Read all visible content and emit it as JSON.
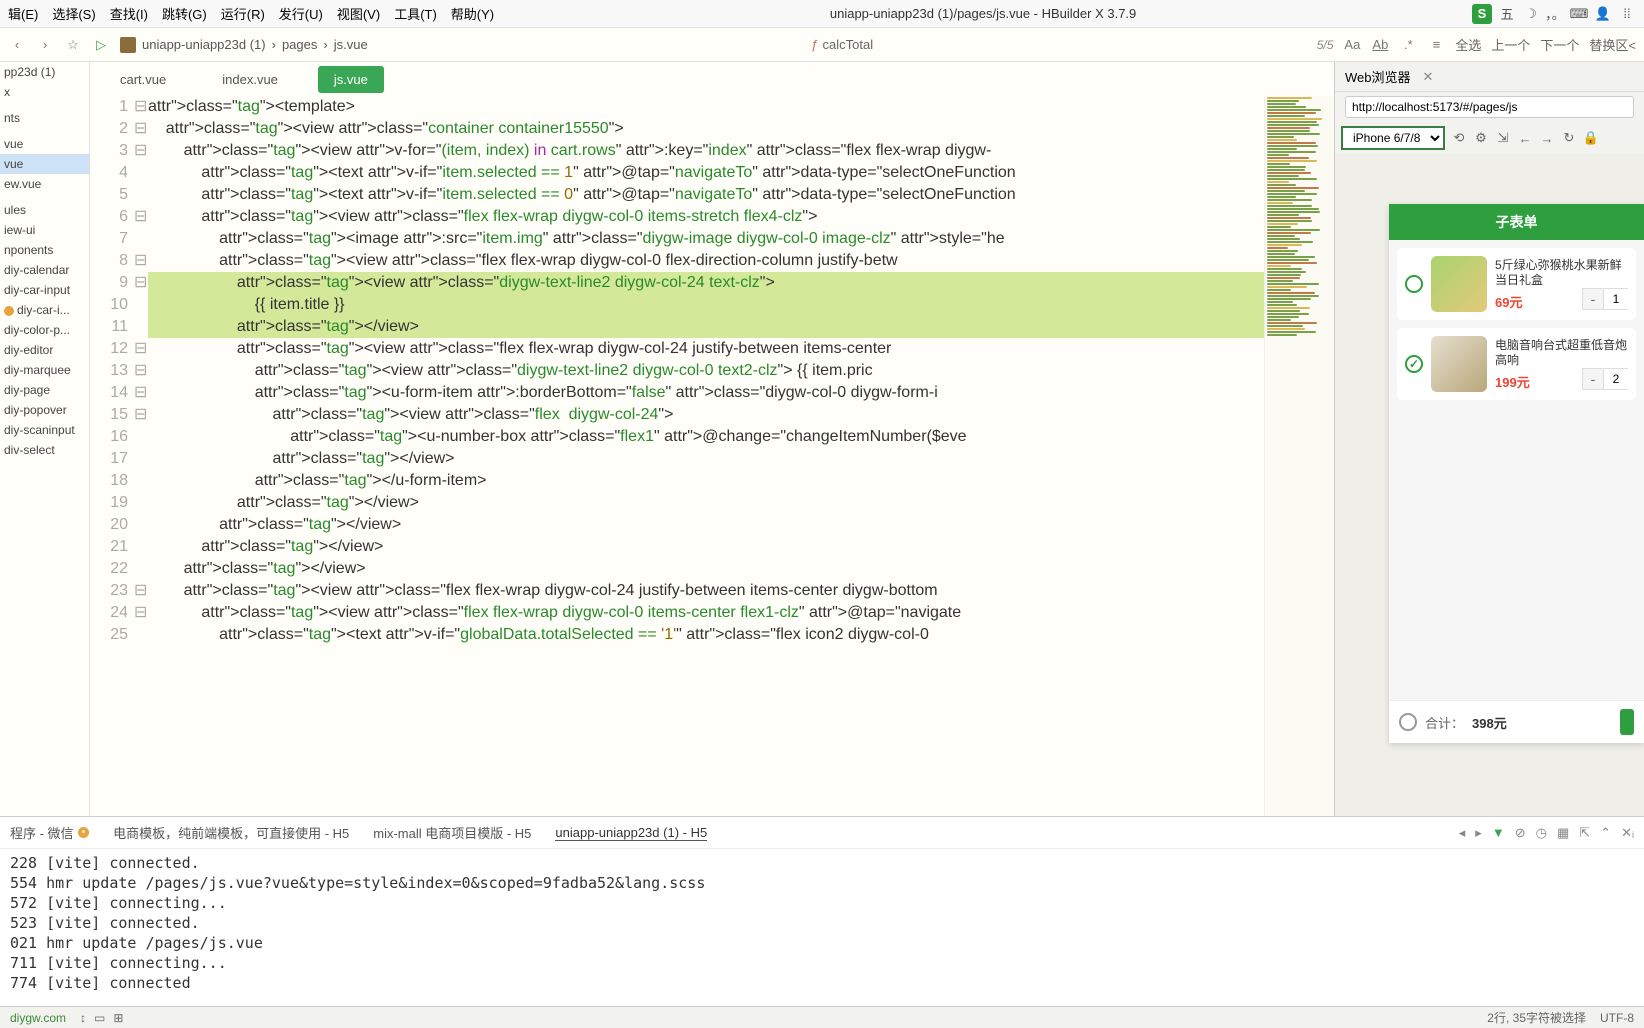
{
  "menubar": {
    "items": [
      "辑(E)",
      "选择(S)",
      "查找(I)",
      "跳转(G)",
      "运行(R)",
      "发行(U)",
      "视图(V)",
      "工具(T)",
      "帮助(Y)"
    ],
    "title": "uniapp-uniapp23d (1)/pages/js.vue - HBuilder X 3.7.9"
  },
  "toolbar": {
    "breadcrumb": [
      "uniapp-uniapp23d (1)",
      "pages",
      "js.vue"
    ],
    "func": "calcTotal",
    "count": "5/5",
    "actions": [
      "全选",
      "上一个",
      "下一个",
      "替换区<"
    ]
  },
  "sidebar": {
    "items": [
      "pp23d (1)",
      "x",
      "",
      "nts",
      "",
      "vue",
      "vue",
      "ew.vue",
      "",
      "ules",
      "iew-ui",
      "nponents",
      "diy-calendar",
      "diy-car-input",
      "diy-car-i...",
      "diy-color-p...",
      "diy-editor",
      "diy-marquee",
      "diy-page",
      "diy-popover",
      "diy-scaninput",
      "div-select"
    ]
  },
  "tabs": [
    {
      "label": "cart.vue",
      "active": false
    },
    {
      "label": "index.vue",
      "active": false
    },
    {
      "label": "js.vue",
      "active": true
    }
  ],
  "code": {
    "lines": [
      "<template>",
      "    <view class=\"container container15550\">",
      "        <view v-for=\"(item, index) in cart.rows\" :key=\"index\" class=\"flex flex-wrap diygw-",
      "            <text v-if=\"item.selected == 1\" @tap=\"navigateTo\" data-type=\"selectOneFunction",
      "            <text v-if=\"item.selected == 0\" @tap=\"navigateTo\" data-type=\"selectOneFunction",
      "            <view class=\"flex flex-wrap diygw-col-0 items-stretch flex4-clz\">",
      "                <image :src=\"item.img\" class=\"diygw-image diygw-col-0 image-clz\" style=\"he",
      "                <view class=\"flex flex-wrap diygw-col-0 flex-direction-column justify-betw",
      "                    <view class=\"diygw-text-line2 diygw-col-24 text-clz\">",
      "                        {{ item.title }}",
      "                    </view>",
      "                    <view class=\"flex flex-wrap diygw-col-24 justify-between items-center ",
      "                        <view class=\"diygw-text-line2 diygw-col-0 text2-clz\"> {{ item.pric",
      "                        <u-form-item :borderBottom=\"false\" class=\"diygw-col-0 diygw-form-i",
      "                            <view class=\"flex  diygw-col-24\">",
      "                                <u-number-box class=\"flex1\" @change=\"changeItemNumber($eve",
      "                            </view>",
      "                        </u-form-item>",
      "                    </view>",
      "                </view>",
      "            </view>",
      "        </view>",
      "        <view class=\"flex flex-wrap diygw-col-24 justify-between items-center diygw-bottom",
      "            <view class=\"flex flex-wrap diygw-col-0 items-center flex1-clz\" @tap=\"navigate",
      "                <text v-if=\"globalData.totalSelected == '1'\" class=\"flex icon2 diygw-col-0"
    ],
    "highlighted": [
      9,
      10,
      11
    ]
  },
  "preview": {
    "tab": "Web浏览器",
    "url": "http://localhost:5173/#/pages/js",
    "device": "iPhone 6/7/8",
    "header": "子表单",
    "products": [
      {
        "title": "5斤绿心弥猴桃水果新鲜当日礼盒",
        "price": "69元",
        "qty": 1,
        "selected": false,
        "img": "kiwi"
      },
      {
        "title": "电脑音响台式超重低音炮高响",
        "price": "199元",
        "qty": 2,
        "selected": true,
        "img": "spk"
      }
    ],
    "footer": {
      "label": "合计：",
      "total": "398元"
    }
  },
  "console": {
    "tabs": [
      {
        "label": "程序 - 微信",
        "badge": true
      },
      {
        "label": "电商模板，纯前端模板，可直接使用 - H5"
      },
      {
        "label": "mix-mall 电商项目模版 - H5"
      },
      {
        "label": "uniapp-uniapp23d (1) - H5",
        "active": true
      }
    ],
    "lines": [
      "228 [vite] connected.",
      "554 hmr update /pages/js.vue?vue&type=style&index=0&scoped=9fadba52&lang.scss",
      "572 [vite] connecting...",
      "523 [vite] connected.",
      "021 hmr update /pages/js.vue",
      "711 [vite] connecting...",
      "774 [vite] connected"
    ]
  },
  "status": {
    "link": "diygw.com",
    "info": "2行, 35字符被选择",
    "encoding": "UTF-8"
  }
}
